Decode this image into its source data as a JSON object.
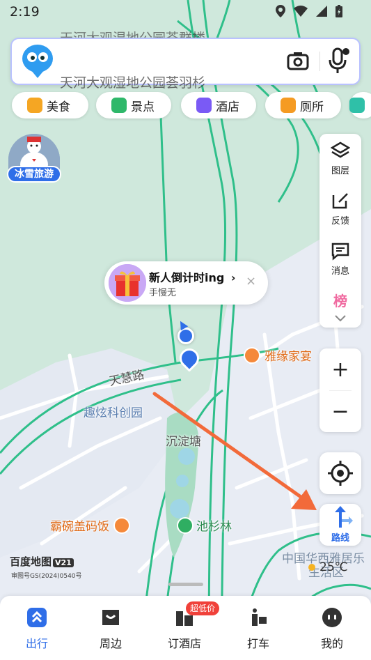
{
  "status_bar": {
    "time": "2:19"
  },
  "search": {
    "scroll_hint_prev": "天河大观湿地公园荟群楼",
    "placeholder_hint": "天河大观湿地公园荟羽杉"
  },
  "chips": [
    {
      "label": "美食",
      "icon": "food-icon",
      "color": "#f5a623"
    },
    {
      "label": "景点",
      "icon": "scenic-icon",
      "color": "#2fb86a"
    },
    {
      "label": "酒店",
      "icon": "hotel-icon",
      "color": "#7a5af5"
    },
    {
      "label": "厕所",
      "icon": "toilet-icon",
      "color": "#f59b23"
    }
  ],
  "promo_badge": {
    "label": "冰雪旅游",
    "banner_text": "冰雪旅游"
  },
  "tools": [
    {
      "label": "图层",
      "icon": "layers-icon"
    },
    {
      "label": "反馈",
      "icon": "feedback-icon"
    },
    {
      "label": "消息",
      "icon": "message-icon"
    },
    {
      "label": "榜",
      "icon": "ranking-icon"
    }
  ],
  "zoom": {
    "in": "+",
    "out": "−"
  },
  "route": {
    "label": "路线"
  },
  "new_user_popup": {
    "title": "新人倒计时ing",
    "subtitle": "手慢无",
    "chevron": "›",
    "close": "×"
  },
  "map_labels": {
    "restaurant_1": "雅缘家宴",
    "road_1": "天慧路",
    "area_1": "趣炫科创园",
    "place_1": "沉淀塘",
    "restaurant_2": "霸碗盖码饭",
    "park_1": "池杉林",
    "community_1": "中国华西雅居乐",
    "community_1_line2": "生活区"
  },
  "attribution": {
    "logo": "百度地图",
    "version": "V21",
    "approval": "审图号GS(2024)0540号"
  },
  "weather": {
    "temp": "25℃"
  },
  "tabs": [
    {
      "label": "出行",
      "icon": "travel-icon",
      "active": true
    },
    {
      "label": "周边",
      "icon": "nearby-icon",
      "active": false
    },
    {
      "label": "订酒店",
      "icon": "hotel-booking-icon",
      "active": false,
      "badge": "超低价"
    },
    {
      "label": "打车",
      "icon": "taxi-icon",
      "active": false
    },
    {
      "label": "我的",
      "icon": "profile-icon",
      "active": false
    }
  ]
}
